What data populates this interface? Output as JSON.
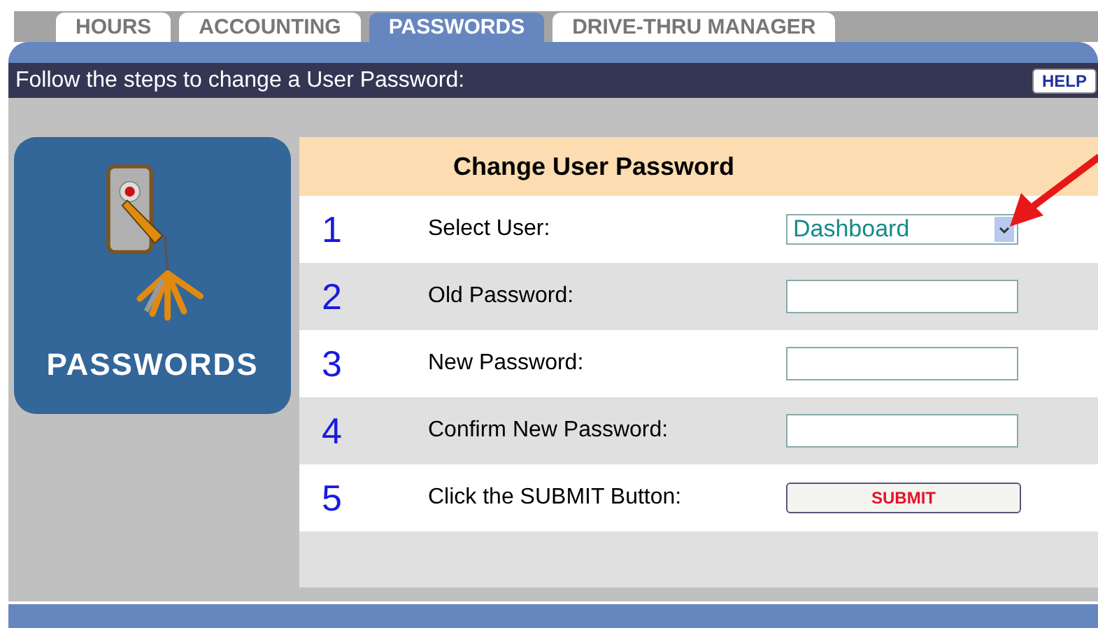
{
  "tabs": [
    {
      "label": "HOURS",
      "selected": false
    },
    {
      "label": "ACCOUNTING",
      "selected": false
    },
    {
      "label": "PASSWORDS",
      "selected": true
    },
    {
      "label": "DRIVE-THRU MANAGER",
      "selected": false
    }
  ],
  "instruction": "Follow the steps to change a User Password:",
  "help_button": "HELP",
  "tile": {
    "label": "PASSWORDS"
  },
  "form": {
    "title": "Change User Password",
    "steps": [
      {
        "number": "1",
        "label": "Select User:",
        "kind": "select",
        "value": "Dashboard"
      },
      {
        "number": "2",
        "label": "Old Password:",
        "kind": "input"
      },
      {
        "number": "3",
        "label": "New Password:",
        "kind": "input"
      },
      {
        "number": "4",
        "label": "Confirm New Password:",
        "kind": "input"
      },
      {
        "number": "5",
        "label": "Click the SUBMIT Button:",
        "kind": "button",
        "value": "SUBMIT"
      }
    ]
  }
}
